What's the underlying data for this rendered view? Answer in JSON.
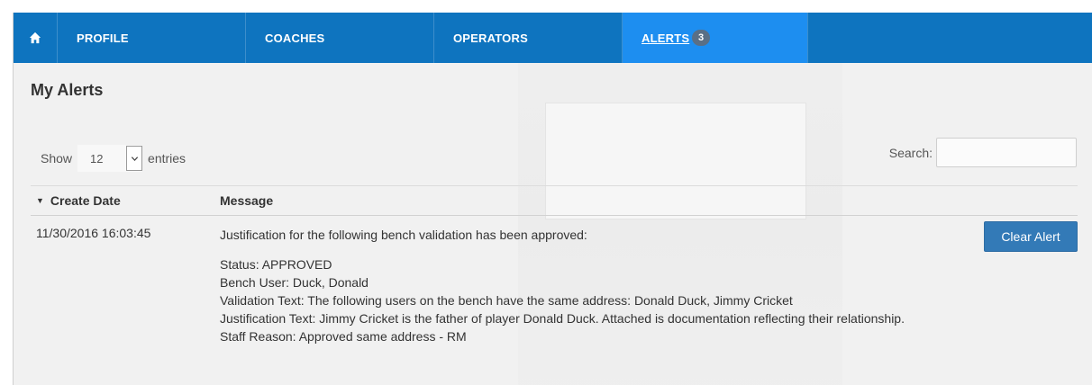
{
  "nav": {
    "home_icon": "home-icon",
    "items": [
      {
        "label": "PROFILE"
      },
      {
        "label": "COACHES"
      },
      {
        "label": "OPERATORS"
      },
      {
        "label": "ALERTS",
        "badge": "3",
        "active": true
      }
    ]
  },
  "page": {
    "title": "My Alerts"
  },
  "entries": {
    "show_label": "Show",
    "value": "12",
    "suffix": "entries"
  },
  "search": {
    "label": "Search:",
    "value": ""
  },
  "table": {
    "columns": [
      "Create Date",
      "Message"
    ],
    "sort_indicator": "▼",
    "rows": [
      {
        "date": "11/30/2016 16:03:45",
        "intro": "Justification for the following bench validation has been approved:",
        "details": [
          "Status: APPROVED",
          "Bench User: Duck, Donald",
          "Validation Text: The following users on the bench have the same address: Donald Duck, Jimmy Cricket",
          "Justification Text: Jimmy Cricket is the father of player Donald Duck. Attached is documentation reflecting their relationship.",
          "Staff Reason: Approved same address - RM"
        ],
        "action_label": "Clear Alert"
      }
    ]
  },
  "colors": {
    "navbar": "#0e74bf",
    "active_tab": "#1d8ef0",
    "badge": "#5a6f85",
    "button": "#337ab7"
  }
}
